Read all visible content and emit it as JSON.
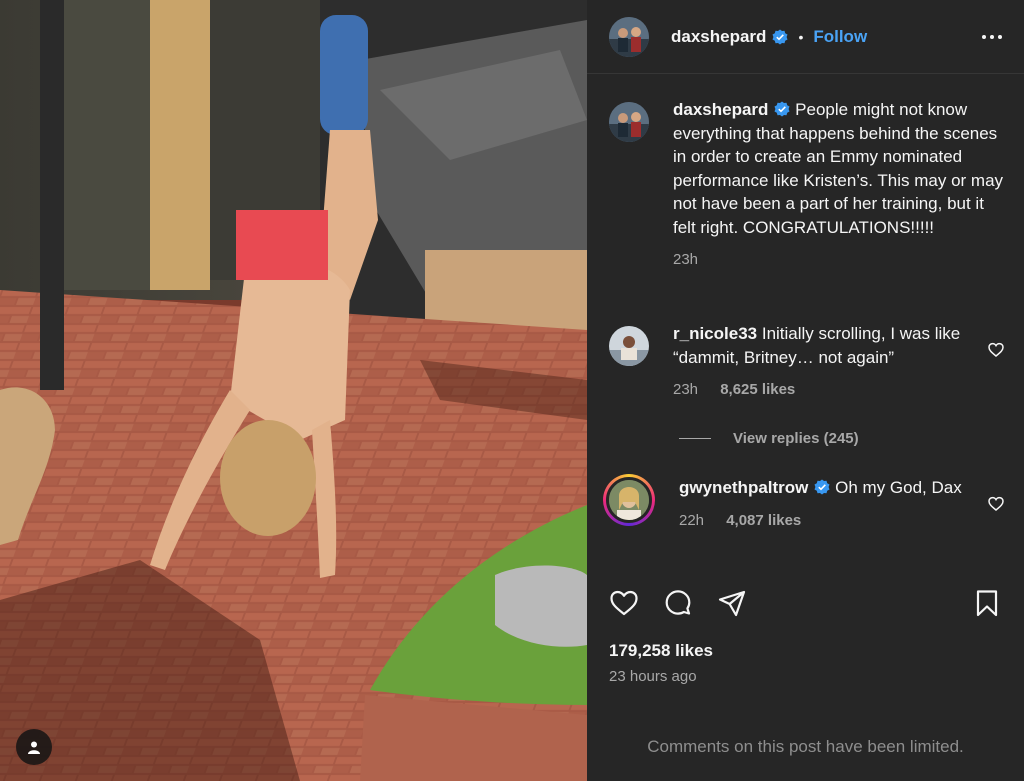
{
  "post": {
    "author": "daxshepard",
    "follow_label": "Follow",
    "caption": {
      "author": "daxshepard",
      "text": "People might not know everything that happens behind the scenes in order to create an Emmy nominated performance like Kristen’s. This may or may not have been a part of her training, but it felt right. CONGRATULATIONS!!!!!",
      "time": "23h"
    },
    "comments": [
      {
        "author": "r_nicole33",
        "text": "Initially scrolling, I was like “dammit, Britney… not again”",
        "time": "23h",
        "likes": "8,625 likes",
        "replies": "View replies (245)"
      },
      {
        "author": "gwynethpaltrow",
        "text": "Oh my God, Dax",
        "time": "22h",
        "likes": "4,087 likes"
      }
    ],
    "likes_total": "179,258 likes",
    "posted_ago": "23 hours ago",
    "comments_notice": "Comments on this post have been limited."
  },
  "icons": {
    "verified": "verified-badge-icon",
    "more": "more-options-icon",
    "like": "heart-icon",
    "comment": "comment-icon",
    "share": "share-icon",
    "save": "bookmark-icon",
    "tag": "user-tag-icon"
  },
  "colors": {
    "panel": "#262626",
    "link": "#4aa3f5",
    "muted": "#a8a8a8",
    "censor": "#e84a52"
  }
}
